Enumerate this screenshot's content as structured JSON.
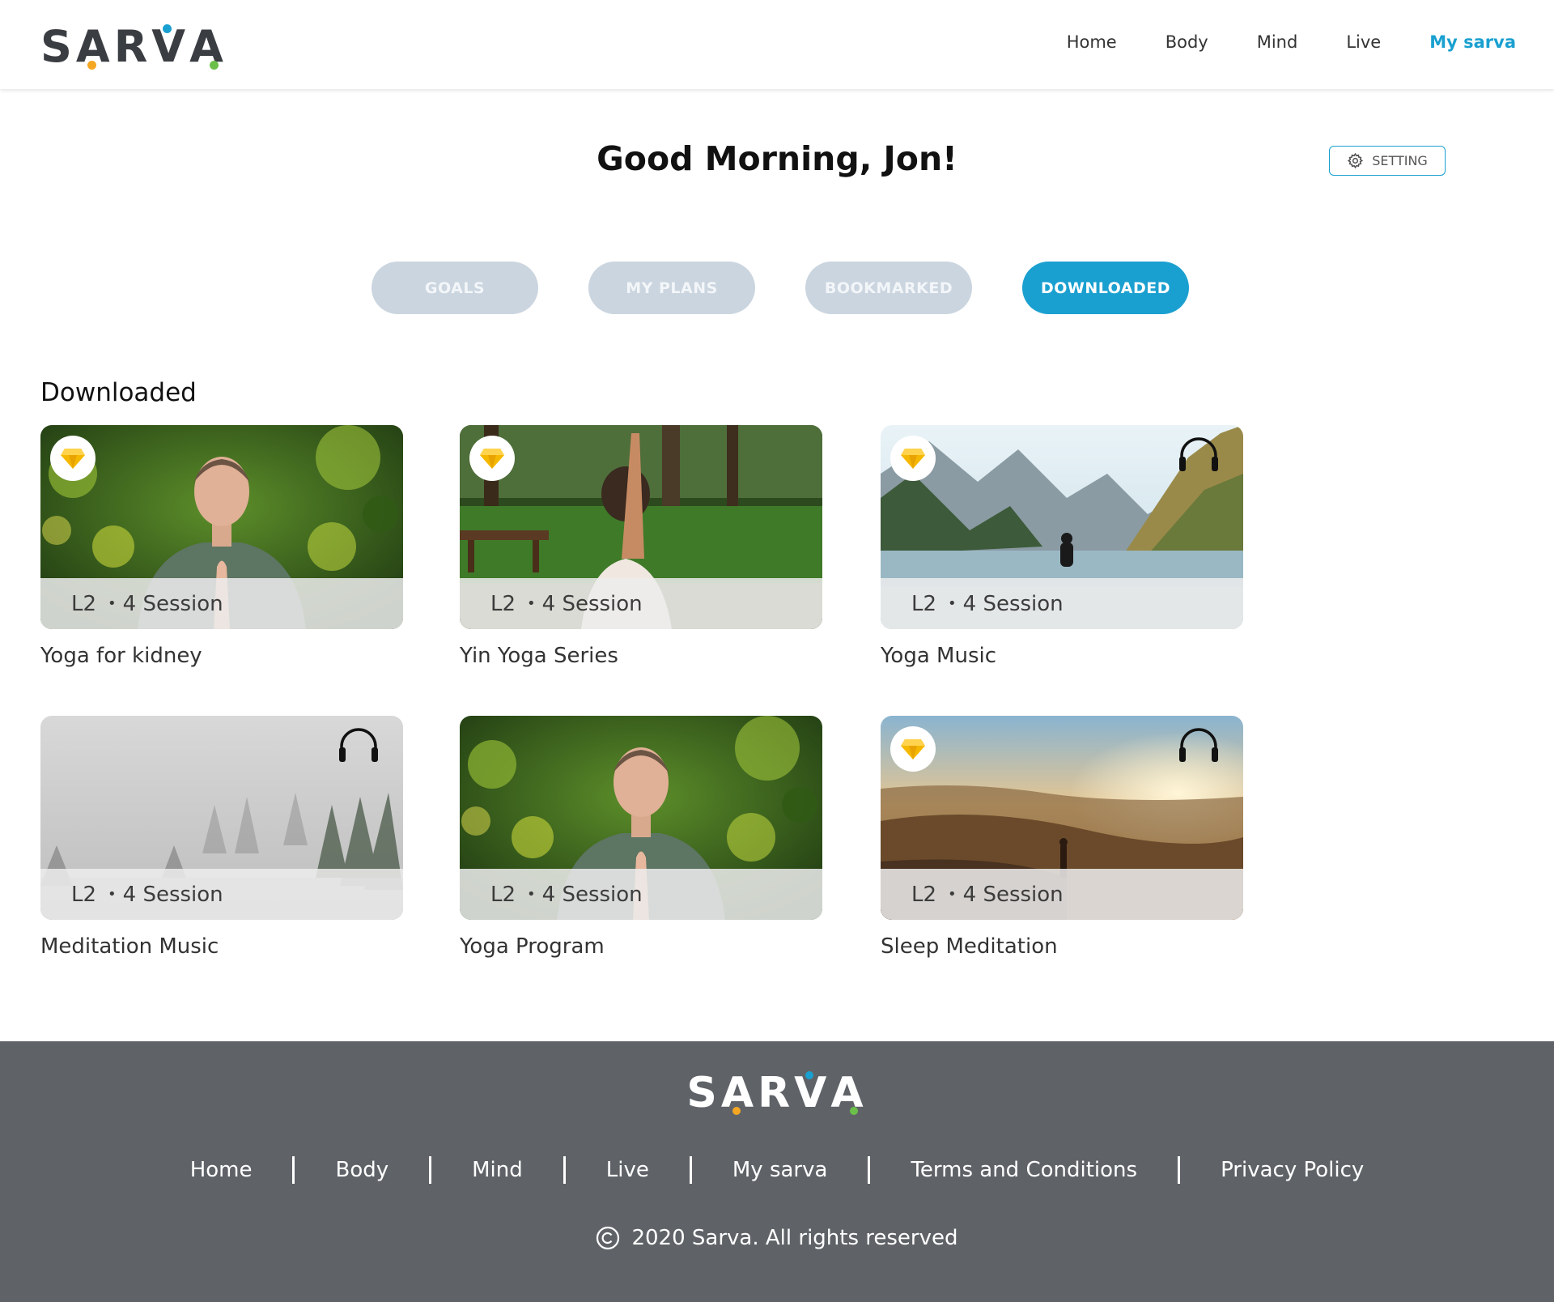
{
  "brand": {
    "name": "SARVA",
    "dot_colors": [
      "#f5a623",
      "#1aa0d0",
      "#6cc04a"
    ]
  },
  "nav": {
    "items": [
      "Home",
      "Body",
      "Mind",
      "Live",
      "My sarva"
    ],
    "active": "My sarva"
  },
  "greeting": "Good Morning, Jon!",
  "setting_label": "SETTING",
  "tabs": [
    {
      "label": "GOALS",
      "active": false
    },
    {
      "label": "MY PLANS",
      "active": false
    },
    {
      "label": "BOOKMARKED",
      "active": false
    },
    {
      "label": "DOWNLOADED",
      "active": true
    }
  ],
  "section_title": "Downloaded",
  "cards": [
    {
      "title": "Yoga for kidney",
      "level": "L2",
      "sessions": "4 Session",
      "premium": true,
      "audio": false,
      "scene": "meditator-forest"
    },
    {
      "title": "Yin Yoga Series",
      "level": "L2",
      "sessions": "4 Session",
      "premium": true,
      "audio": false,
      "scene": "yoga-park"
    },
    {
      "title": "Yoga Music",
      "level": "L2",
      "sessions": "4 Session",
      "premium": true,
      "audio": true,
      "scene": "mountain-lake"
    },
    {
      "title": "Meditation Music",
      "level": "L2",
      "sessions": "4 Session",
      "premium": false,
      "audio": true,
      "scene": "misty-forest"
    },
    {
      "title": "Yoga Program",
      "level": "L2",
      "sessions": "4 Session",
      "premium": false,
      "audio": false,
      "scene": "meditator-forest"
    },
    {
      "title": "Sleep Meditation",
      "level": "L2",
      "sessions": "4 Session",
      "premium": true,
      "audio": true,
      "scene": "sunset-hills"
    }
  ],
  "footer": {
    "links": [
      "Home",
      "Body",
      "Mind",
      "Live",
      "My sarva",
      "Terms and Conditions",
      "Privacy Policy"
    ],
    "copyright": "2020 Sarva. All rights reserved"
  },
  "colors": {
    "accent": "#1aa0d0",
    "tab_inactive": "#cbd5df",
    "footer_bg": "#5f6368",
    "gem": "#f5b800"
  }
}
